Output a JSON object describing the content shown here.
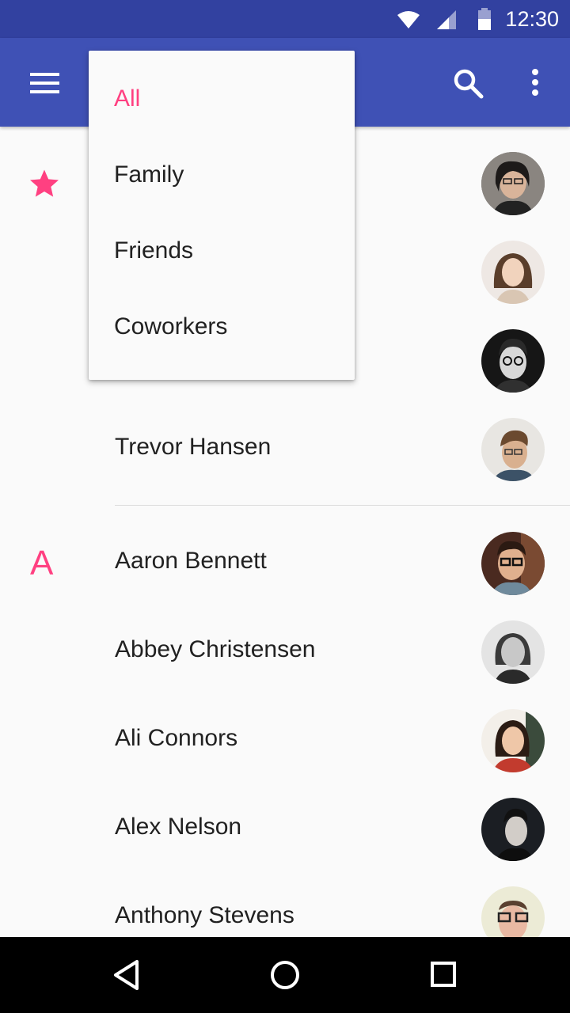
{
  "status_bar": {
    "time": "12:30",
    "icons": [
      "wifi-icon",
      "signal-icon",
      "battery-icon"
    ],
    "background": "#3241a0"
  },
  "app_bar": {
    "background": "#3f51b5",
    "icons": [
      "menu-icon",
      "search-icon",
      "overflow-menu-icon"
    ]
  },
  "dropdown": {
    "items": [
      {
        "label": "All",
        "selected": true
      },
      {
        "label": "Family",
        "selected": false
      },
      {
        "label": "Friends",
        "selected": false
      },
      {
        "label": "Coworkers",
        "selected": false
      }
    ]
  },
  "favorites": {
    "section_icon": "star-icon",
    "contacts": [
      {
        "name": "Trevor Hansen"
      }
    ]
  },
  "section_a": {
    "letter": "A",
    "contacts": [
      {
        "name": "Aaron Bennett"
      },
      {
        "name": "Abbey Christensen"
      },
      {
        "name": "Ali Connors"
      },
      {
        "name": "Alex Nelson"
      },
      {
        "name": "Anthony Stevens"
      }
    ]
  },
  "nav_bar": {
    "icons": [
      "back-icon",
      "home-icon",
      "recents-icon"
    ]
  },
  "colors": {
    "accent": "#ff4081",
    "primary": "#3f51b5",
    "primary_dark": "#3241a0"
  }
}
